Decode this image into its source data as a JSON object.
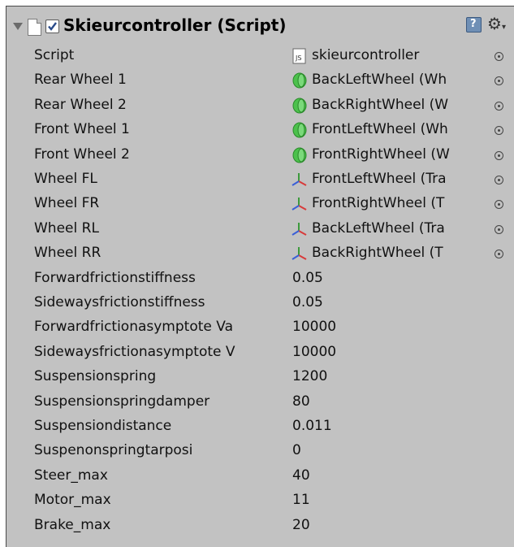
{
  "component": {
    "title": "Skieurcontroller (Script)",
    "enabled": true,
    "icons": {
      "foldout": "foldout-arrow-icon",
      "script": "script-file-icon",
      "help": "help-icon",
      "settings": "gear-icon"
    }
  },
  "object_fields": [
    {
      "label": "Script",
      "value": "skieurcontroller",
      "icon": "js-file-icon"
    },
    {
      "label": "Rear Wheel 1",
      "value": "BackLeftWheel (Wh",
      "icon": "wheel-collider-icon"
    },
    {
      "label": "Rear Wheel 2",
      "value": "BackRightWheel (W",
      "icon": "wheel-collider-icon"
    },
    {
      "label": "Front Wheel 1",
      "value": "FrontLeftWheel (Wh",
      "icon": "wheel-collider-icon"
    },
    {
      "label": "Front Wheel 2",
      "value": "FrontRightWheel (W",
      "icon": "wheel-collider-icon"
    },
    {
      "label": "Wheel FL",
      "value": "FrontLeftWheel (Tra",
      "icon": "transform-icon"
    },
    {
      "label": "Wheel FR",
      "value": "FrontRightWheel (T",
      "icon": "transform-icon"
    },
    {
      "label": "Wheel RL",
      "value": "BackLeftWheel (Tra",
      "icon": "transform-icon"
    },
    {
      "label": "Wheel RR",
      "value": "BackRightWheel (T",
      "icon": "transform-icon"
    }
  ],
  "number_fields": [
    {
      "label": "Forwardfrictionstiffness",
      "value": "0.05"
    },
    {
      "label": "Sidewaysfrictionstiffness",
      "value": "0.05"
    },
    {
      "label": "Forwardfrictionasymptote Va",
      "value": "10000"
    },
    {
      "label": "Sidewaysfrictionasymptote V",
      "value": "10000"
    },
    {
      "label": "Suspensionspring",
      "value": "1200"
    },
    {
      "label": "Suspensionspringdamper",
      "value": "80"
    },
    {
      "label": "Suspensiondistance",
      "value": "0.011"
    },
    {
      "label": "Suspenonspringtarposi",
      "value": "0"
    },
    {
      "label": "Steer_max",
      "value": "40"
    },
    {
      "label": "Motor_max",
      "value": "11"
    },
    {
      "label": "Brake_max",
      "value": "20"
    }
  ],
  "colors": {
    "panel_bg": "#c2c2c2",
    "wheel_icon": "#3fbf3f",
    "border": "#4a4a4a"
  }
}
